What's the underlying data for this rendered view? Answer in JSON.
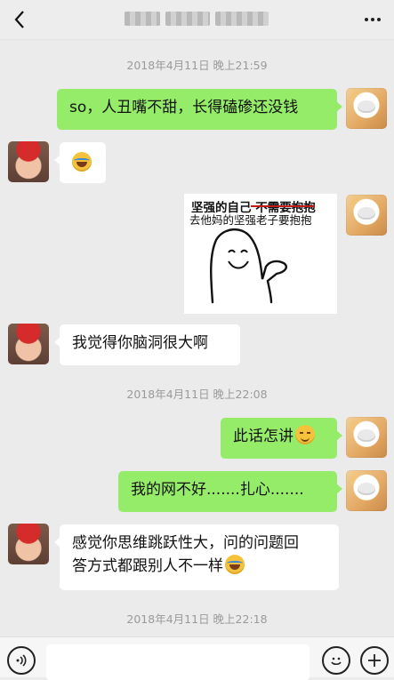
{
  "header": {
    "back_icon": "chevron-left-icon",
    "more_icon": "more-dots-icon"
  },
  "messages": {
    "t1": "2018年4月11日 晚上21:59",
    "m1": "so，人丑嘴不甜，长得磕碜还没钱",
    "t2": "2018年4月11日 晚上22:08",
    "m2": "我觉得你脑洞很大啊",
    "m3": "此话怎讲",
    "m4": "我的网不好.......扎心.......",
    "m5_line1": "感觉你思维跳跃性大，问的问题回",
    "m5_line2": "答方式都跟别人不一样",
    "t3": "2018年4月11日 晚上22:18"
  },
  "sticker": {
    "line1": "坚强的自己 不需要抱抱",
    "line2": "去他妈的坚强老子要抱抱"
  },
  "colors": {
    "my_bubble": "#95ec69",
    "their_bubble": "#ffffff",
    "background": "#ebebeb"
  },
  "input": {
    "voice_icon": "voice-icon",
    "emoji_icon": "emoji-icon",
    "plus_icon": "plus-icon"
  }
}
